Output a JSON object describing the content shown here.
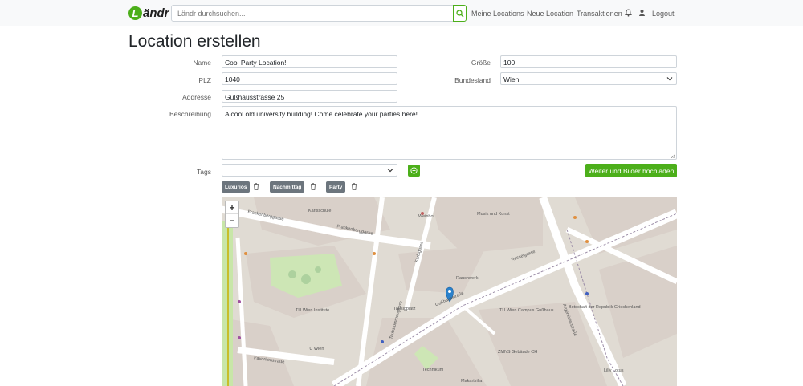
{
  "nav": {
    "brand": "Ländr",
    "brand_initial": "L",
    "brand_rest": "ändr",
    "search_placeholder": "Ländr durchsuchen...",
    "links": [
      "Meine Locations",
      "Neue Location",
      "Transaktionen"
    ],
    "logout": "Logout",
    "accent_color": "#4caf1a"
  },
  "page": {
    "title": "Location erstellen"
  },
  "form": {
    "name_label": "Name",
    "name_value": "Cool Party Location!",
    "plz_label": "PLZ",
    "plz_value": "1040",
    "address_label": "Addresse",
    "address_value": "Gußhausstrasse 25",
    "size_label": "Größe",
    "size_value": "100",
    "state_label": "Bundesland",
    "state_value": "Wien",
    "description_label": "Beschreibung",
    "description_value": "A cool old university building! Come celebrate your parties here!",
    "tags_label": "Tags",
    "tags_value": "",
    "next_button": "Weiter und Bilder hochladen"
  },
  "tags": [
    "Luxuriös",
    "Nachmittag",
    "Party"
  ],
  "map": {
    "zoom_in": "+",
    "zoom_out": "−",
    "street_labels": [
      "Frankenberggasse",
      "Frankenberggasse",
      "Karlsgasse",
      "Gußhausstraße",
      "Taubstummengasse",
      "Argentinierstraße",
      "Favoritenstraße",
      "Resselgasse"
    ],
    "poi_labels": [
      "Karlsschule",
      "Musik und Kunst",
      "Weinhof",
      "Rauchwerk",
      "TU Wien Institute",
      "TU Wien",
      "TU Wien Campus Gußhaus",
      "ZMNS Gebäude CH",
      "Makartvilla",
      "Technikum",
      "Botschaft der Republik Griechenland",
      "Lilly Lotus",
      "Tausigplatz"
    ]
  }
}
